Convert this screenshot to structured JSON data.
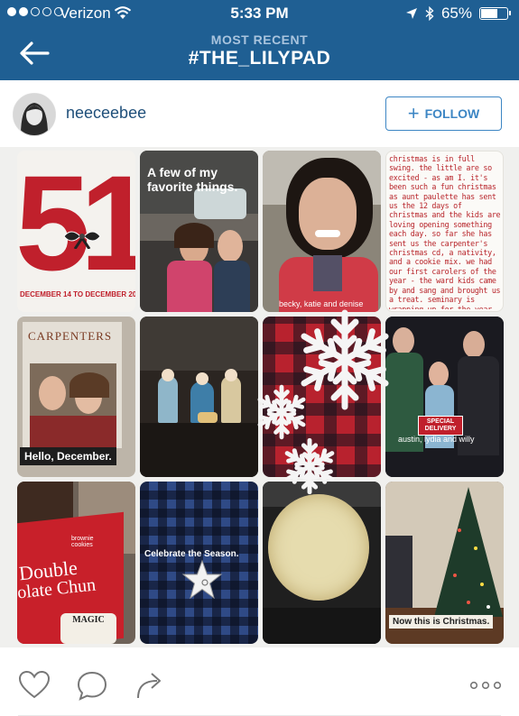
{
  "status_bar": {
    "carrier": "Verizon",
    "time": "5:33 PM",
    "battery": "65%",
    "battery_level": 0.65
  },
  "nav": {
    "subtitle": "MOST RECENT",
    "title": "#THE_LILYPAD"
  },
  "post_header": {
    "username": "neeceebee",
    "follow_label": "FOLLOW"
  },
  "collage": {
    "tile1_number": "51",
    "tile1_dates": "DECEMBER 14 TO DECEMBER 20",
    "tile2_title": "A few of my favorite things.",
    "tile3_caption": "becky, katie and denise",
    "tile4_journal": "christmas is in full swing. the little are so excited - as am I. it's been such a fun christmas as aunt paulette has sent us the 12 days of christmas and the kids are loving opening something each day. so far she has sent us the carpenter's christmas cd, a nativity, and a cookie mix. we had our first carolers of the year - the ward kids came by and sang and brought us a treat. seminary is wrapping up for the year. I'm so happy for christmas break! but we had breakfast with the kids to send them off on break.",
    "tile5_album": "CARPENTERS",
    "tile5_caption": "Hello, December.",
    "tile8_badge": "SPECIAL DELIVERY",
    "tile8_caption": "austin, lydia and willy",
    "tile9_package_line1": "Double",
    "tile9_package_line2": "olate Chun",
    "tile9_package_small": "brownie cookies",
    "tile9_tag": "MAGIC",
    "tile10_caption": "Celebrate the Season.",
    "tile12_caption": "Now this is Christmas."
  },
  "icons": {
    "back": "arrow-left-icon",
    "like": "heart-icon",
    "comment": "comment-icon",
    "share": "share-arrow-icon",
    "more": "more-dots-icon",
    "follow_plus": "plus-icon"
  },
  "colors": {
    "header_blue": "#1f5f93",
    "follow_blue": "#3d86c4",
    "username_blue": "#1f4f7a",
    "accent_red": "#c0202c"
  }
}
